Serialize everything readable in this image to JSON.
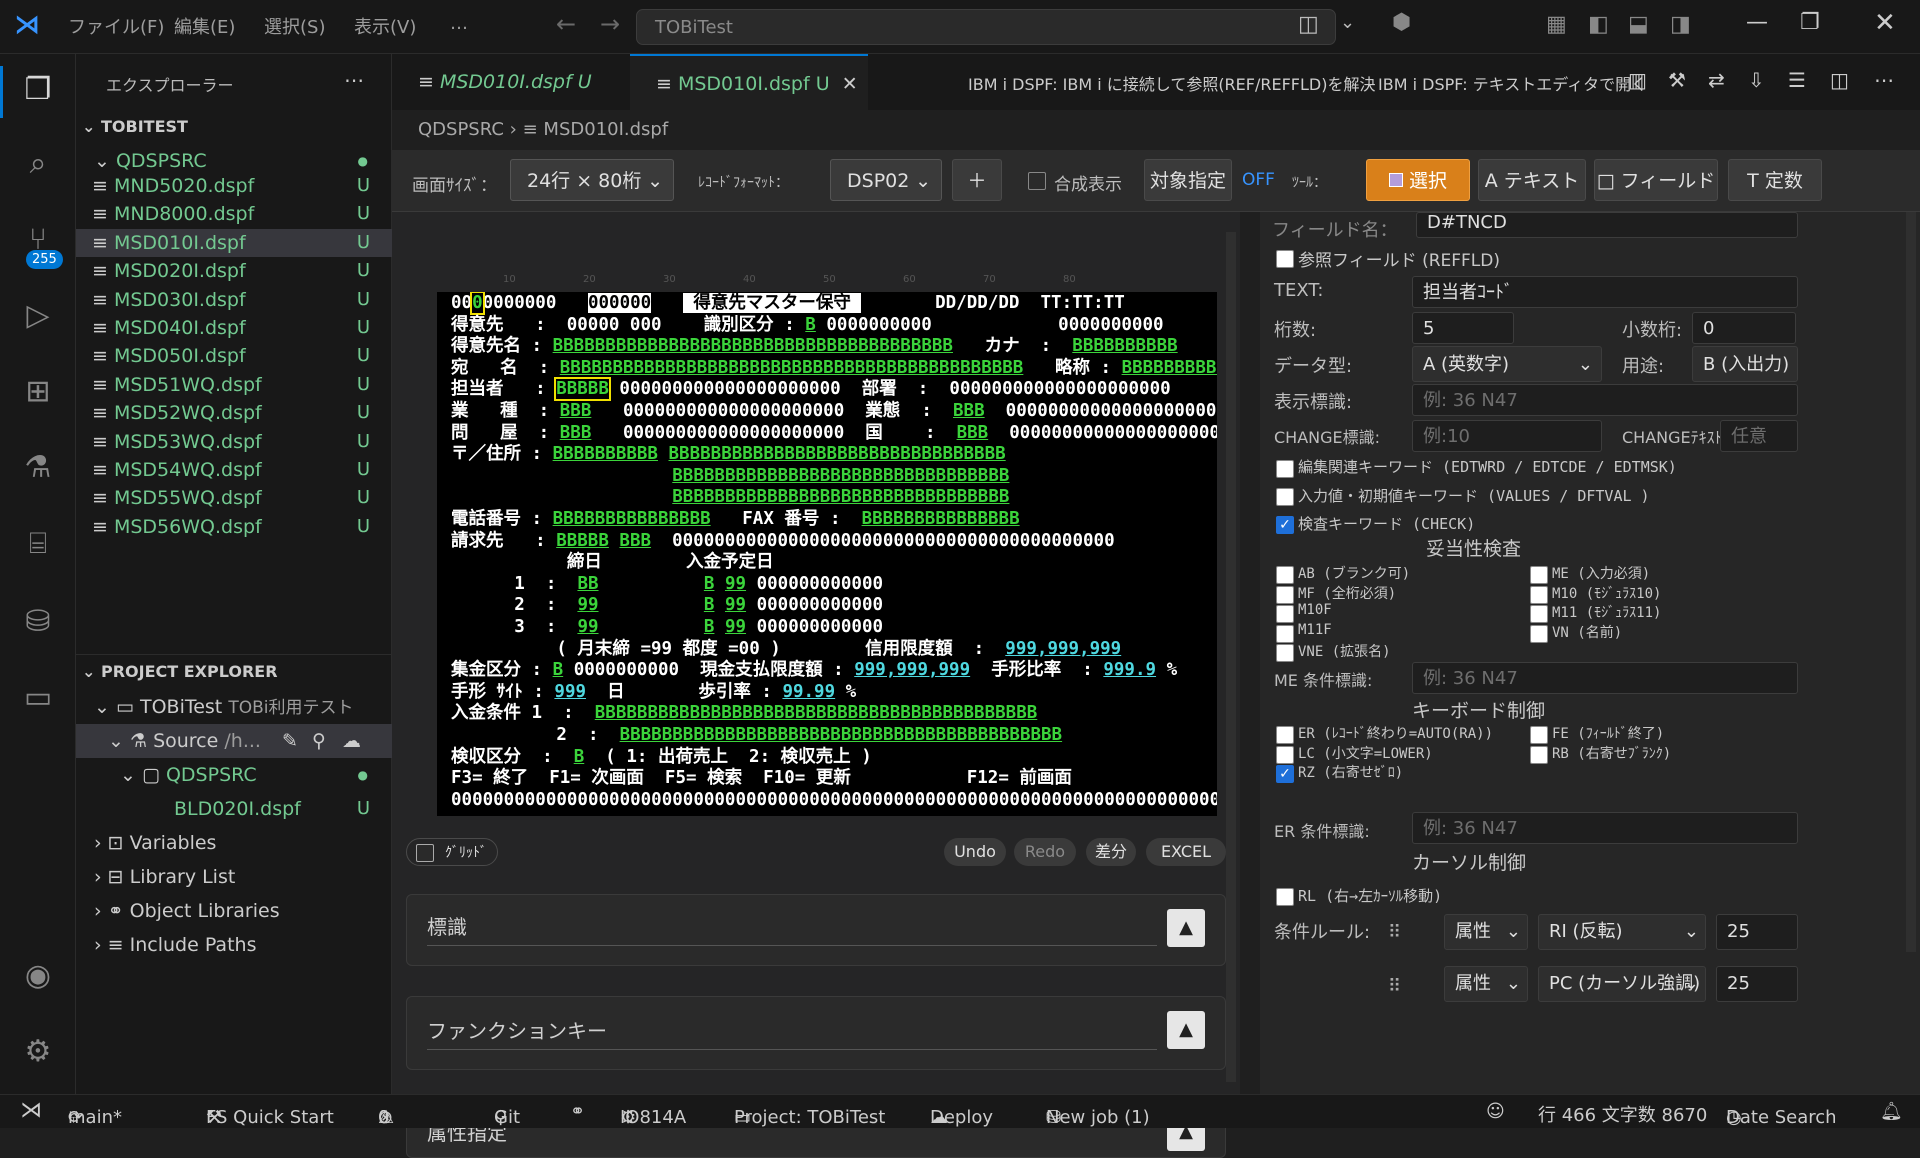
{
  "titlebar": {
    "menu": [
      "ファイル(F)",
      "編集(E)",
      "選択(S)",
      "表示(V)",
      "…"
    ],
    "command_center": "TOBiTest"
  },
  "sidebar": {
    "title": "エクスプローラー",
    "root": "TOBITEST",
    "folder": "QDSPSRC",
    "files": [
      {
        "name": "MND5020.dspf",
        "status": "U"
      },
      {
        "name": "MND8000.dspf",
        "status": "U"
      },
      {
        "name": "MSD010I.dspf",
        "status": "U"
      },
      {
        "name": "MSD020I.dspf",
        "status": "U"
      },
      {
        "name": "MSD030I.dspf",
        "status": "U"
      },
      {
        "name": "MSD040I.dspf",
        "status": "U"
      },
      {
        "name": "MSD050I.dspf",
        "status": "U"
      },
      {
        "name": "MSD51WQ.dspf",
        "status": "U"
      },
      {
        "name": "MSD52WQ.dspf",
        "status": "U"
      },
      {
        "name": "MSD53WQ.dspf",
        "status": "U"
      },
      {
        "name": "MSD54WQ.dspf",
        "status": "U"
      },
      {
        "name": "MSD55WQ.dspf",
        "status": "U"
      },
      {
        "name": "MSD56WQ.dspf",
        "status": "U"
      }
    ],
    "project_explorer": "PROJECT EXPLORER",
    "project": "TOBiTest",
    "project_desc": "TOBi利用テスト",
    "source": "Source",
    "source_path": "/h...",
    "src_folder": "QDSPSRC",
    "src_file": "BLD020I.dspf",
    "src_file_status": "U",
    "items": [
      "Variables",
      "Library List",
      "Object Libraries",
      "Include Paths"
    ]
  },
  "activity_badge": "255",
  "editor": {
    "tabs": [
      {
        "label": "MSD010I.dspf",
        "status": "U"
      },
      {
        "label": "MSD010I.dspf",
        "status": "U"
      }
    ],
    "actions": [
      "IBM i DSPF: IBM i に接続して参照(REF/REFFLD)を解決",
      "IBM i DSPF: テキストエディタで開く"
    ],
    "breadcrumb": [
      "QDSPSRC",
      "MSD010I.dspf"
    ]
  },
  "toolbar": {
    "screen_size_label": "画面ｻｲｽﾞ：",
    "screen_size": "24行 × 80桁",
    "record_format_label": "ﾚｺｰﾄﾞﾌｫｰﾏｯﾄ：",
    "record_format": "DSP02",
    "add": "＋",
    "composite_label": "合成表示",
    "target_btn": "対象指定",
    "off": "OFF",
    "tool_label": "ﾂｰﾙ：",
    "tool_select": "選択",
    "tool_text": "A テキスト",
    "tool_field": "□ フィールド",
    "tool_const": "T 定数"
  },
  "screen": {
    "ruler": [
      "10",
      "20",
      "30",
      "40",
      "50",
      "60",
      "70",
      "80"
    ],
    "lines": [
      [
        [
          "00",
          "w"
        ],
        [
          "0",
          "box"
        ],
        [
          "0000000   ",
          "w"
        ],
        [
          "000000",
          "inv"
        ],
        [
          "   ",
          "w"
        ],
        [
          " 得意先マスター保守 ",
          "inv"
        ],
        [
          "       DD/DD/DD  TT:TT:TT",
          "w"
        ]
      ],
      [
        [
          "得意先   :  00000 000    識別区分 : ",
          "w"
        ],
        [
          "B",
          "g"
        ],
        [
          " 0000000000            0000000000",
          "w"
        ]
      ],
      [
        [
          "得意先名 : ",
          "w"
        ],
        [
          "BBBBBBBBBBBBBBBBBBBBBBBBBBBBBBBBBBBBBB",
          "g"
        ],
        [
          "   カナ  :  ",
          "w"
        ],
        [
          "BBBBBBBBBB",
          "g"
        ]
      ],
      [
        [
          "宛   名  : ",
          "w"
        ],
        [
          "BBBBBBBBBBBBBBBBBBBBBBBBBBBBBBBBBBBBBBBBBBBB",
          "g"
        ],
        [
          "   略称 : ",
          "w"
        ],
        [
          "BBBBBBBBBBBBBBBBBBBBBB",
          "g"
        ]
      ],
      [
        [
          "担当者   : ",
          "w"
        ],
        [
          "BBBBB",
          "box"
        ],
        [
          " 000000000000000000000  部署  :  000000000000000000000",
          "w"
        ]
      ],
      [
        [
          "業   種  : ",
          "w"
        ],
        [
          "BBB",
          "g"
        ],
        [
          "   000000000000000000000  業態  :  ",
          "w"
        ],
        [
          "BBB",
          "g"
        ],
        [
          "  000000000000000000000",
          "w"
        ]
      ],
      [
        [
          "問   屋  : ",
          "w"
        ],
        [
          "BBB",
          "g"
        ],
        [
          "   000000000000000000000  国    :  ",
          "w"
        ],
        [
          "BBB",
          "g"
        ],
        [
          "  000000000000000000000",
          "w"
        ]
      ],
      [
        [
          "〒／住所 : ",
          "w"
        ],
        [
          "BBBBBBBBBB",
          "g"
        ],
        [
          " ",
          "w"
        ],
        [
          "BBBBBBBBBBBBBBBBBBBBBBBBBBBBBBBB",
          "g"
        ]
      ],
      [
        [
          "                     ",
          "w"
        ],
        [
          "BBBBBBBBBBBBBBBBBBBBBBBBBBBBBBBB",
          "g"
        ]
      ],
      [
        [
          "                     ",
          "w"
        ],
        [
          "BBBBBBBBBBBBBBBBBBBBBBBBBBBBBBBB",
          "g"
        ]
      ],
      [
        [
          "電話番号 : ",
          "w"
        ],
        [
          "BBBBBBBBBBBBBBB",
          "g"
        ],
        [
          "   FAX 番号 :  ",
          "w"
        ],
        [
          "BBBBBBBBBBBBBBB",
          "g"
        ]
      ],
      [
        [
          "請求先   : ",
          "w"
        ],
        [
          "BBBBB",
          "g"
        ],
        [
          " ",
          "w"
        ],
        [
          "BBB",
          "g"
        ],
        [
          "  000000000000000000000000000000000000000000",
          "w"
        ]
      ],
      [
        [
          "           締日        入金予定日       ",
          "w"
        ]
      ],
      [
        [
          "      1  :  ",
          "w"
        ],
        [
          "BB",
          "g"
        ],
        [
          "          ",
          "w"
        ],
        [
          "B",
          "g"
        ],
        [
          " ",
          "w"
        ],
        [
          "99",
          "g"
        ],
        [
          " 000000000000",
          "w"
        ]
      ],
      [
        [
          "      2  :  ",
          "w"
        ],
        [
          "99",
          "g"
        ],
        [
          "          ",
          "w"
        ],
        [
          "B",
          "g"
        ],
        [
          " ",
          "w"
        ],
        [
          "99",
          "g"
        ],
        [
          " 000000000000",
          "w"
        ]
      ],
      [
        [
          "      3  :  ",
          "w"
        ],
        [
          "99",
          "g"
        ],
        [
          "          ",
          "w"
        ],
        [
          "B",
          "g"
        ],
        [
          " ",
          "w"
        ],
        [
          "99",
          "g"
        ],
        [
          " 000000000000",
          "w"
        ]
      ],
      [
        [
          "          ( 月末締 =99 都度 =00 )        信用限度額  :  ",
          "w"
        ],
        [
          "999,999,999",
          "c"
        ]
      ],
      [
        [
          "集金区分 : ",
          "w"
        ],
        [
          "B",
          "g"
        ],
        [
          " 0000000000  現金支払限度額 : ",
          "w"
        ],
        [
          "999,999,999",
          "c"
        ],
        [
          "  手形比率  : ",
          "w"
        ],
        [
          "999.9",
          "c"
        ],
        [
          " %",
          "w"
        ]
      ],
      [
        [
          "手形 ｻｲﾄ : ",
          "w"
        ],
        [
          "999",
          "c"
        ],
        [
          "  日       歩引率 : ",
          "w"
        ],
        [
          "99.99",
          "c"
        ],
        [
          " %",
          "w"
        ]
      ],
      [
        [
          "入金条件 1  :  ",
          "w"
        ],
        [
          "BBBBBBBBBBBBBBBBBBBBBBBBBBBBBBBBBBBBBBBBBB",
          "g"
        ]
      ],
      [
        [
          "          2  :  ",
          "w"
        ],
        [
          "BBBBBBBBBBBBBBBBBBBBBBBBBBBBBBBBBBBBBBBBBB",
          "g"
        ]
      ],
      [
        [
          "検収区分  :  ",
          "w"
        ],
        [
          "B",
          "g"
        ],
        [
          "  ( 1: 出荷売上  2: 検収売上 )",
          "w"
        ]
      ],
      [
        [
          "F3= 終了  F1= 次画面  F5= 検索  F10= 更新           F12= 前画面",
          "w"
        ]
      ],
      [
        [
          "0000000000000000000000000000000000000000000000000000000000000000000000000000000",
          "w"
        ]
      ]
    ]
  },
  "designer": {
    "grid_label": "ｸﾞﾘｯﾄﾞ",
    "undo": "Undo",
    "redo": "Redo",
    "diff": "差分",
    "excel": "EXCEL",
    "sections": [
      "標識",
      "ファンクションキー",
      "属性指定"
    ]
  },
  "props": {
    "field_name_label": "フィールド名：",
    "field_name": "D#TNCD",
    "reffld_label": "参照フィールド (REFFLD)",
    "text_label": "TEXT:",
    "text_value": "担当者ｺｰﾄﾞ",
    "digits_label": "桁数:",
    "digits": "5",
    "decimal_label": "小数桁:",
    "decimal": "0",
    "datatype_label": "データ型:",
    "datatype": "A (英数字)",
    "usage_label": "用途:",
    "usage": "B (入出力)",
    "ind_label": "表示標識:",
    "ind_placeholder": "例: 36 N47",
    "change_ind_label": "CHANGE標識:",
    "change_ind_placeholder": "例:10",
    "change_text_label": "CHANGEﾃｷｽﾄ:",
    "change_text_placeholder": "任意",
    "edit_kw": "編集関連キーワード (EDTWRD / EDTCDE / EDTMSK)",
    "values_kw": "入力値・初期値キーワード (VALUES / DFTVAL )",
    "check_kw": "検査キーワード (CHECK)",
    "validity": "妥当性検査",
    "checks_left": [
      "AB (ブランク可)",
      "MF (全桁必須)",
      "M10F",
      "M11F",
      "VNE (拡張名)"
    ],
    "checks_right": [
      "ME (入力必須)",
      "M10 (ﾓｼﾞｭﾗｽ10)",
      "M11 (ﾓｼﾞｭﾗｽ11)",
      "VN (名前)"
    ],
    "me_label": "ME 条件標識:",
    "me_placeholder": "例: 36 N47",
    "keyboard": "キーボード制御",
    "kb_left": [
      "ER (ﾚｺｰﾄﾞ終わり=AUTO(RA))",
      "LC (小文字=LOWER)",
      "RZ (右寄せｾﾞﾛ)"
    ],
    "kb_right": [
      "FE (ﾌｨｰﾙﾄﾞ終了)",
      "RB (右寄せﾌﾞﾗﾝｸ)"
    ],
    "er_label": "ER 条件標識:",
    "er_placeholder": "例: 36 N47",
    "cursor": "カーソル制御",
    "rl": "RL (右→左ｶｰｿﾙ移動)",
    "rule_label": "条件ルール:",
    "rules": [
      {
        "kind": "属性",
        "value": "RI (反転)",
        "num": "25"
      },
      {
        "kind": "属性",
        "value": "PC (カーソル強調)",
        "num": "25"
      }
    ]
  },
  "statusbar": {
    "branch": "main*",
    "quick": "FS Quick Start",
    "errors": "0",
    "warnings": "0",
    "git": "Git",
    "host": "IO814A",
    "project": "Project: TOBiTest",
    "deploy": "Deploy",
    "job": "New job (1)",
    "position": "行 466 文字数 8670",
    "search": "Date Search"
  }
}
